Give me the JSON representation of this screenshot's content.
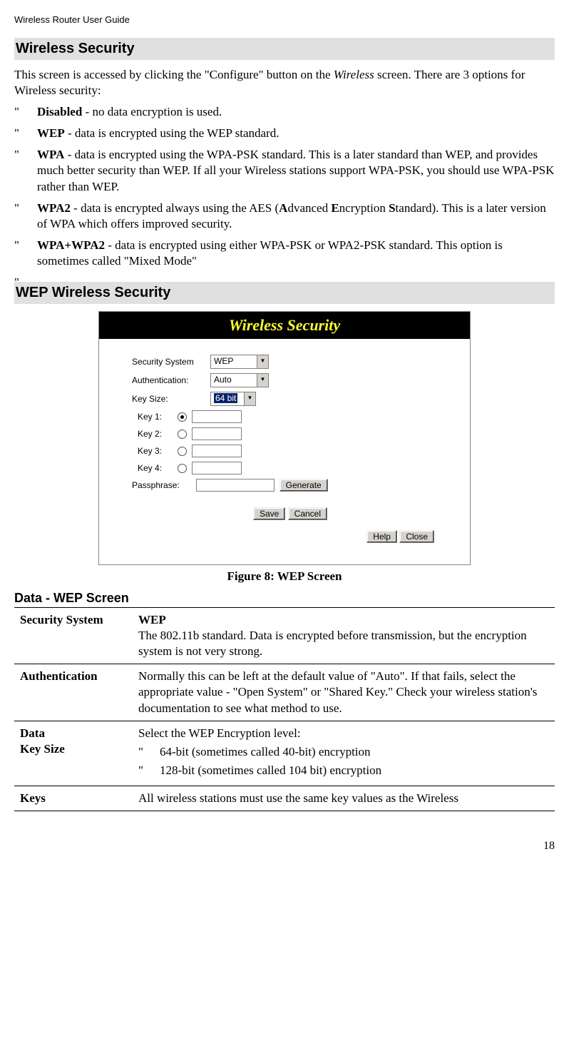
{
  "header": "Wireless Router User Guide",
  "section1": {
    "title": "Wireless Security",
    "intro_pre": "This screen is accessed by clicking the \"Configure\" button on the ",
    "intro_italic": "Wireless",
    "intro_post": " screen. There are 3 options for Wireless security:",
    "bullets": [
      {
        "bold": "Disabled",
        "text": " - no data encryption is used."
      },
      {
        "bold": "WEP",
        "text": " - data is encrypted using the WEP standard."
      },
      {
        "bold": "WPA",
        "text": " - data is encrypted using the WPA-PSK standard. This is a later standard than WEP, and provides much better security than WEP. If all your Wireless stations support WPA-PSK, you should use WPA-PSK rather than WEP."
      },
      {
        "bold": "WPA2",
        "text": " - data is encrypted always using the AES (Advanced Encryption Standard). This is a later version of WPA which offers improved security.",
        "aes_pre": " - data is encrypted always using the AES (",
        "aes_a": "A",
        "aes_a2": "dvanced ",
        "aes_e": "E",
        "aes_e2": "ncryption ",
        "aes_s": "S",
        "aes_s2": "tandard). This is a later version of WPA which offers improved security."
      },
      {
        "bold": "WPA+WPA2",
        "text": " - data is encrypted using either WPA-PSK or WPA2-PSK standard. This option is sometimes called \"Mixed Mode\""
      }
    ]
  },
  "section2": {
    "title": "WEP Wireless Security"
  },
  "screenshot": {
    "title": "Wireless Security",
    "security_system_label": "Security System",
    "security_system_value": "WEP",
    "auth_label": "Authentication:",
    "auth_value": "Auto",
    "keysize_label": "Key Size:",
    "keysize_value": "64 bit",
    "key_labels": [
      "Key 1:",
      "Key 2:",
      "Key 3:",
      "Key 4:"
    ],
    "passphrase_label": "Passphrase:",
    "generate_btn": "Generate",
    "save_btn": "Save",
    "cancel_btn": "Cancel",
    "help_btn": "Help",
    "close_btn": "Close"
  },
  "figure_caption": "Figure 8: WEP Screen",
  "datatable": {
    "heading": "Data - WEP Screen",
    "rows": {
      "sec_sys_label": "Security System",
      "sec_sys_bold": "WEP",
      "sec_sys_text": "The 802.11b standard. Data is encrypted before transmission, but the encryption system is not very strong.",
      "auth_label": "Authentication",
      "auth_text": "Normally this can be left at the default value of \"Auto\". If that fails, select the appropriate value - \"Open System\" or \"Shared Key.\" Check your wireless station's documentation to see what method to use.",
      "data_label1": "Data",
      "data_label2": "Key Size",
      "data_text": "Select the WEP Encryption level:",
      "data_bullets": [
        "64-bit (sometimes called 40-bit) encryption",
        "128-bit (sometimes called 104 bit) encryption"
      ],
      "keys_label": "Keys",
      "keys_text": "All wireless stations must use the same key values as the Wireless"
    }
  },
  "page_number": "18"
}
